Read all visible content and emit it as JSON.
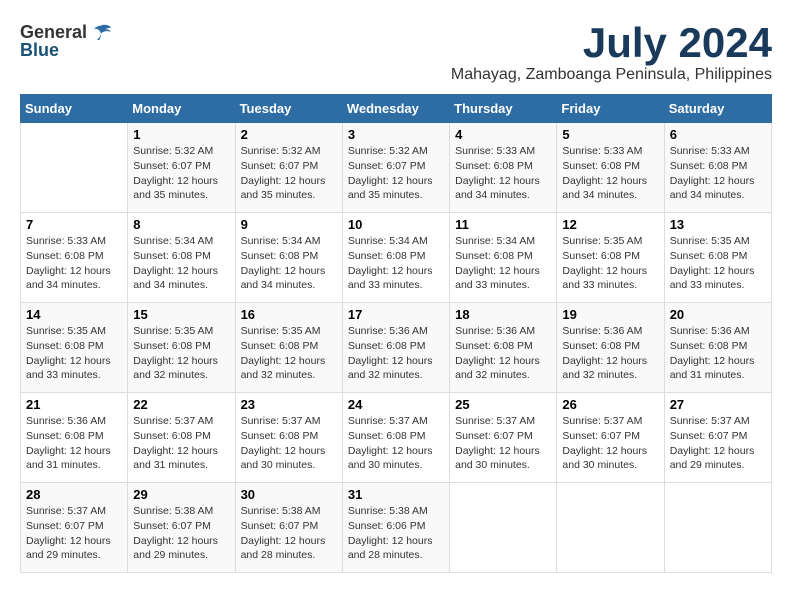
{
  "logo": {
    "general": "General",
    "blue": "Blue"
  },
  "title": "July 2024",
  "location": "Mahayag, Zamboanga Peninsula, Philippines",
  "days_of_week": [
    "Sunday",
    "Monday",
    "Tuesday",
    "Wednesday",
    "Thursday",
    "Friday",
    "Saturday"
  ],
  "weeks": [
    [
      {
        "day": "",
        "sunrise": "",
        "sunset": "",
        "daylight": ""
      },
      {
        "day": "1",
        "sunrise": "Sunrise: 5:32 AM",
        "sunset": "Sunset: 6:07 PM",
        "daylight": "Daylight: 12 hours and 35 minutes."
      },
      {
        "day": "2",
        "sunrise": "Sunrise: 5:32 AM",
        "sunset": "Sunset: 6:07 PM",
        "daylight": "Daylight: 12 hours and 35 minutes."
      },
      {
        "day": "3",
        "sunrise": "Sunrise: 5:32 AM",
        "sunset": "Sunset: 6:07 PM",
        "daylight": "Daylight: 12 hours and 35 minutes."
      },
      {
        "day": "4",
        "sunrise": "Sunrise: 5:33 AM",
        "sunset": "Sunset: 6:08 PM",
        "daylight": "Daylight: 12 hours and 34 minutes."
      },
      {
        "day": "5",
        "sunrise": "Sunrise: 5:33 AM",
        "sunset": "Sunset: 6:08 PM",
        "daylight": "Daylight: 12 hours and 34 minutes."
      },
      {
        "day": "6",
        "sunrise": "Sunrise: 5:33 AM",
        "sunset": "Sunset: 6:08 PM",
        "daylight": "Daylight: 12 hours and 34 minutes."
      }
    ],
    [
      {
        "day": "7",
        "sunrise": "Sunrise: 5:33 AM",
        "sunset": "Sunset: 6:08 PM",
        "daylight": "Daylight: 12 hours and 34 minutes."
      },
      {
        "day": "8",
        "sunrise": "Sunrise: 5:34 AM",
        "sunset": "Sunset: 6:08 PM",
        "daylight": "Daylight: 12 hours and 34 minutes."
      },
      {
        "day": "9",
        "sunrise": "Sunrise: 5:34 AM",
        "sunset": "Sunset: 6:08 PM",
        "daylight": "Daylight: 12 hours and 34 minutes."
      },
      {
        "day": "10",
        "sunrise": "Sunrise: 5:34 AM",
        "sunset": "Sunset: 6:08 PM",
        "daylight": "Daylight: 12 hours and 33 minutes."
      },
      {
        "day": "11",
        "sunrise": "Sunrise: 5:34 AM",
        "sunset": "Sunset: 6:08 PM",
        "daylight": "Daylight: 12 hours and 33 minutes."
      },
      {
        "day": "12",
        "sunrise": "Sunrise: 5:35 AM",
        "sunset": "Sunset: 6:08 PM",
        "daylight": "Daylight: 12 hours and 33 minutes."
      },
      {
        "day": "13",
        "sunrise": "Sunrise: 5:35 AM",
        "sunset": "Sunset: 6:08 PM",
        "daylight": "Daylight: 12 hours and 33 minutes."
      }
    ],
    [
      {
        "day": "14",
        "sunrise": "Sunrise: 5:35 AM",
        "sunset": "Sunset: 6:08 PM",
        "daylight": "Daylight: 12 hours and 33 minutes."
      },
      {
        "day": "15",
        "sunrise": "Sunrise: 5:35 AM",
        "sunset": "Sunset: 6:08 PM",
        "daylight": "Daylight: 12 hours and 32 minutes."
      },
      {
        "day": "16",
        "sunrise": "Sunrise: 5:35 AM",
        "sunset": "Sunset: 6:08 PM",
        "daylight": "Daylight: 12 hours and 32 minutes."
      },
      {
        "day": "17",
        "sunrise": "Sunrise: 5:36 AM",
        "sunset": "Sunset: 6:08 PM",
        "daylight": "Daylight: 12 hours and 32 minutes."
      },
      {
        "day": "18",
        "sunrise": "Sunrise: 5:36 AM",
        "sunset": "Sunset: 6:08 PM",
        "daylight": "Daylight: 12 hours and 32 minutes."
      },
      {
        "day": "19",
        "sunrise": "Sunrise: 5:36 AM",
        "sunset": "Sunset: 6:08 PM",
        "daylight": "Daylight: 12 hours and 32 minutes."
      },
      {
        "day": "20",
        "sunrise": "Sunrise: 5:36 AM",
        "sunset": "Sunset: 6:08 PM",
        "daylight": "Daylight: 12 hours and 31 minutes."
      }
    ],
    [
      {
        "day": "21",
        "sunrise": "Sunrise: 5:36 AM",
        "sunset": "Sunset: 6:08 PM",
        "daylight": "Daylight: 12 hours and 31 minutes."
      },
      {
        "day": "22",
        "sunrise": "Sunrise: 5:37 AM",
        "sunset": "Sunset: 6:08 PM",
        "daylight": "Daylight: 12 hours and 31 minutes."
      },
      {
        "day": "23",
        "sunrise": "Sunrise: 5:37 AM",
        "sunset": "Sunset: 6:08 PM",
        "daylight": "Daylight: 12 hours and 30 minutes."
      },
      {
        "day": "24",
        "sunrise": "Sunrise: 5:37 AM",
        "sunset": "Sunset: 6:08 PM",
        "daylight": "Daylight: 12 hours and 30 minutes."
      },
      {
        "day": "25",
        "sunrise": "Sunrise: 5:37 AM",
        "sunset": "Sunset: 6:07 PM",
        "daylight": "Daylight: 12 hours and 30 minutes."
      },
      {
        "day": "26",
        "sunrise": "Sunrise: 5:37 AM",
        "sunset": "Sunset: 6:07 PM",
        "daylight": "Daylight: 12 hours and 30 minutes."
      },
      {
        "day": "27",
        "sunrise": "Sunrise: 5:37 AM",
        "sunset": "Sunset: 6:07 PM",
        "daylight": "Daylight: 12 hours and 29 minutes."
      }
    ],
    [
      {
        "day": "28",
        "sunrise": "Sunrise: 5:37 AM",
        "sunset": "Sunset: 6:07 PM",
        "daylight": "Daylight: 12 hours and 29 minutes."
      },
      {
        "day": "29",
        "sunrise": "Sunrise: 5:38 AM",
        "sunset": "Sunset: 6:07 PM",
        "daylight": "Daylight: 12 hours and 29 minutes."
      },
      {
        "day": "30",
        "sunrise": "Sunrise: 5:38 AM",
        "sunset": "Sunset: 6:07 PM",
        "daylight": "Daylight: 12 hours and 28 minutes."
      },
      {
        "day": "31",
        "sunrise": "Sunrise: 5:38 AM",
        "sunset": "Sunset: 6:06 PM",
        "daylight": "Daylight: 12 hours and 28 minutes."
      },
      {
        "day": "",
        "sunrise": "",
        "sunset": "",
        "daylight": ""
      },
      {
        "day": "",
        "sunrise": "",
        "sunset": "",
        "daylight": ""
      },
      {
        "day": "",
        "sunrise": "",
        "sunset": "",
        "daylight": ""
      }
    ]
  ]
}
